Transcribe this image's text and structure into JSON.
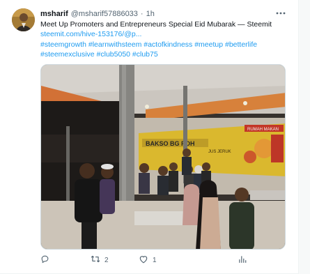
{
  "tweet": {
    "author_name": "msharif",
    "author_handle": "@msharif57886033",
    "separator": "·",
    "time": "1h",
    "text_line1": "Meet Up Promoters and Entrepreneurs Special Eid Mubarak — Steemit",
    "link": "steemit.com/hive-153176/@p...",
    "hashtags_line1": "#steemgrowth #learnwithsteem #actofkindness #meetup #betterlife",
    "hashtags_line2": "#steemexclusive #club5050 #club75",
    "more_icon": "more-horizontal-icon"
  },
  "photo": {
    "signs": [
      "BAKSO BG POH",
      "JUS JERUK",
      "RUMAH MAKAN"
    ]
  },
  "actions": {
    "reply_count": "",
    "retweet_count": "2",
    "like_count": "1",
    "views_count": "",
    "icons": [
      "reply-icon",
      "retweet-icon",
      "like-icon",
      "views-icon",
      "share-icon"
    ]
  },
  "colors": {
    "link": "#1d9bf0",
    "text": "#0f1419",
    "muted": "#536471"
  }
}
